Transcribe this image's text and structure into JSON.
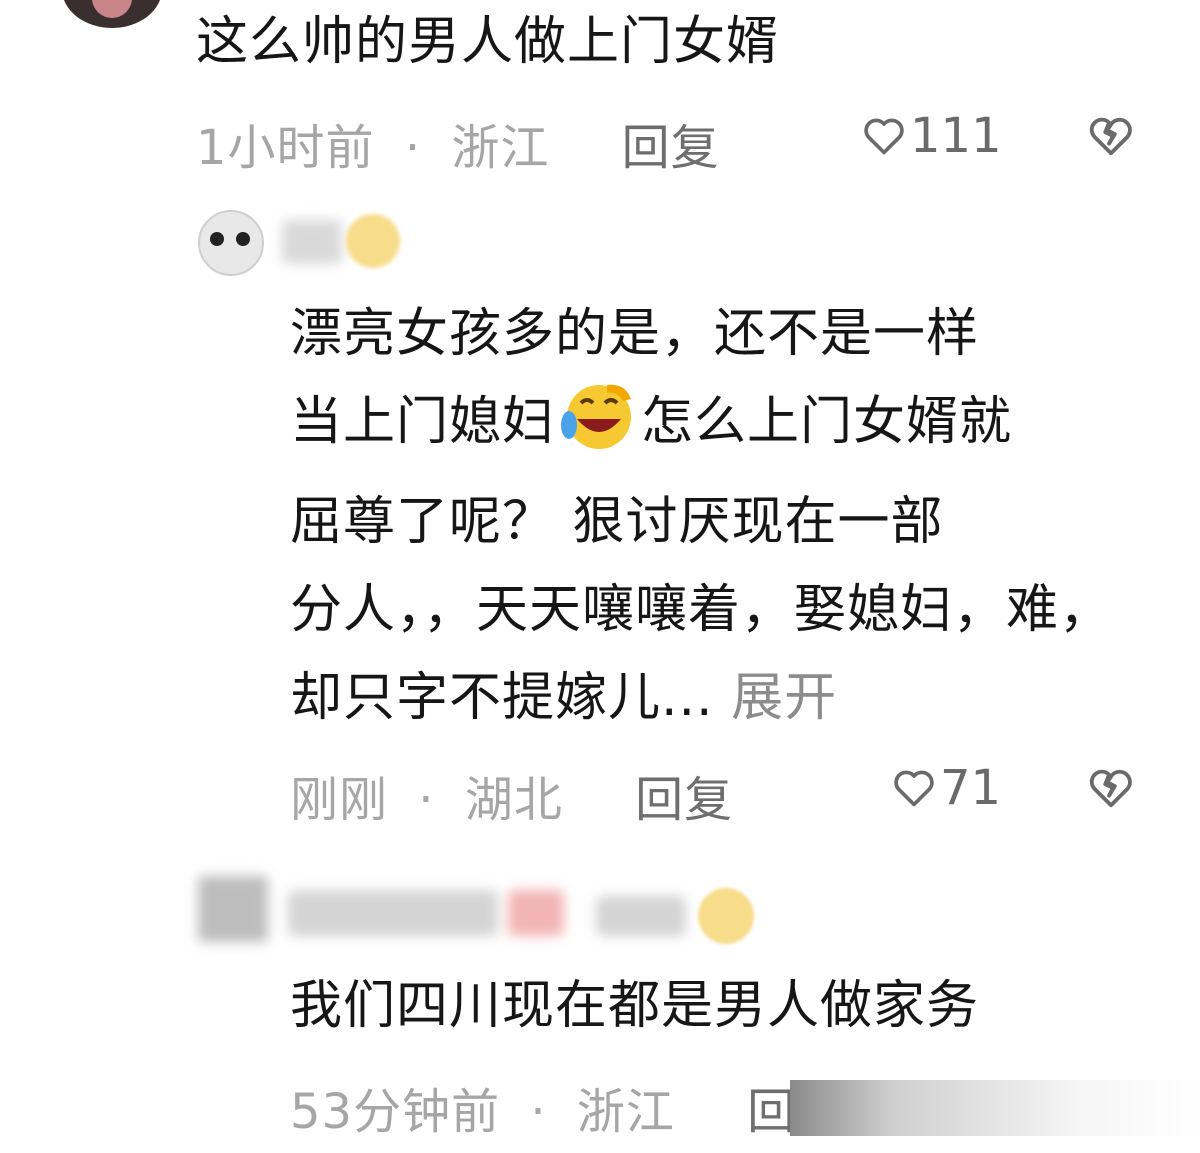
{
  "comments": [
    {
      "text": "这么帅的男人做上门女婿",
      "time": "1小时前",
      "location": "浙江",
      "reply_label": "回复",
      "likes": "111"
    },
    {
      "lines": [
        "漂亮女孩多的是，还不是一样",
        "当上门媳妇",
        "怎么上门女婿就",
        "屈尊了呢？    狠讨厌现在一部",
        "分人，，天天嚷嚷着，娶媳妇，难，",
        "却只字不提嫁儿..."
      ],
      "expand_label": "展开",
      "time": "刚刚",
      "location": "湖北",
      "reply_label": "回复",
      "likes": "71"
    },
    {
      "text": "我们四川现在都是男人做家务",
      "time": "53分钟前",
      "location": "浙江",
      "reply_label": "回"
    }
  ],
  "separator": "·",
  "icons": {
    "like": "heart-outline-icon",
    "dislike": "broken-heart-icon",
    "laugh": "rolling-laugh-emoji",
    "smirk": "smirk-emoji"
  },
  "colors": {
    "text": "#161616",
    "meta": "#a6a6a6",
    "reply": "#6e6e6e"
  }
}
